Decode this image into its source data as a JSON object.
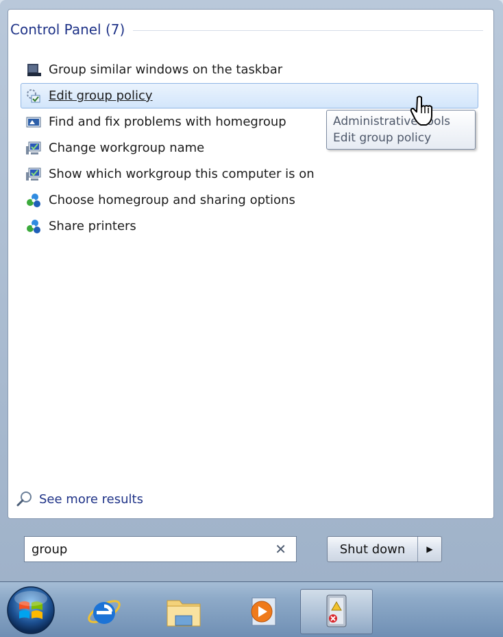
{
  "group": {
    "title": "Control Panel (7)"
  },
  "items": [
    {
      "label": "Group similar windows on the taskbar",
      "icon": "taskbar-icon"
    },
    {
      "label": "Edit group policy",
      "icon": "group-policy-icon"
    },
    {
      "label": "Find and fix problems with homegroup",
      "icon": "troubleshoot-icon"
    },
    {
      "label": "Change workgroup name",
      "icon": "system-computer-icon"
    },
    {
      "label": "Show which workgroup this computer is on",
      "icon": "system-computer-icon"
    },
    {
      "label": "Choose homegroup and sharing options",
      "icon": "homegroup-icon"
    },
    {
      "label": "Share printers",
      "icon": "homegroup-icon"
    }
  ],
  "tooltip": {
    "line1": "Administrative Tools",
    "line2": "Edit group policy"
  },
  "see_more": {
    "label": "See more results",
    "icon": "search-icon"
  },
  "search": {
    "value": "group"
  },
  "shutdown": {
    "label": "Shut down"
  },
  "taskbar": {
    "start": "windows-start-orb-icon",
    "pinned": [
      "internet-explorer-icon",
      "file-explorer-icon",
      "media-player-icon",
      "group-policy-editor-icon"
    ]
  },
  "colors": {
    "link": "#1e3287",
    "hover": "#d3e6fb",
    "hover_border": "#8fb5e4"
  }
}
